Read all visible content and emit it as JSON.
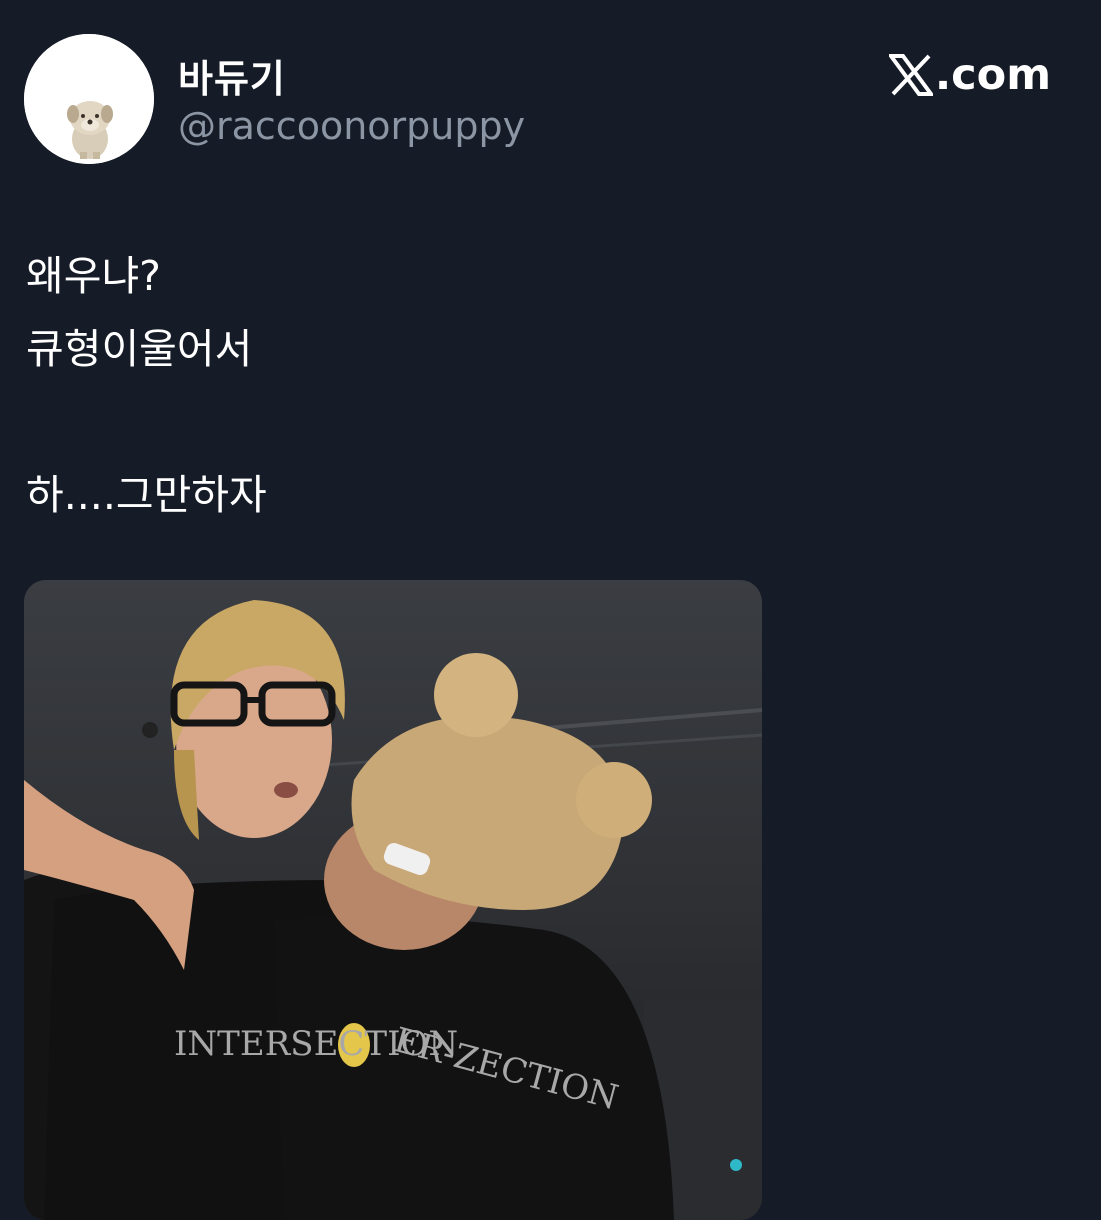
{
  "header": {
    "display_name": "바듀기",
    "handle": "@raccoonorpuppy",
    "brand": ".com",
    "brand_icon": "x-logo-icon"
  },
  "tweet": {
    "lines": [
      "왜우냐?",
      "큐형이울어서",
      "",
      "하....그만하자"
    ]
  },
  "media": {
    "shirt_text_left": "INTERSECTION",
    "shirt_text_right": "ER-ZECTION"
  },
  "colors": {
    "background": "#161c27",
    "text_primary": "#ffffff",
    "text_secondary": "#8b95a3"
  }
}
